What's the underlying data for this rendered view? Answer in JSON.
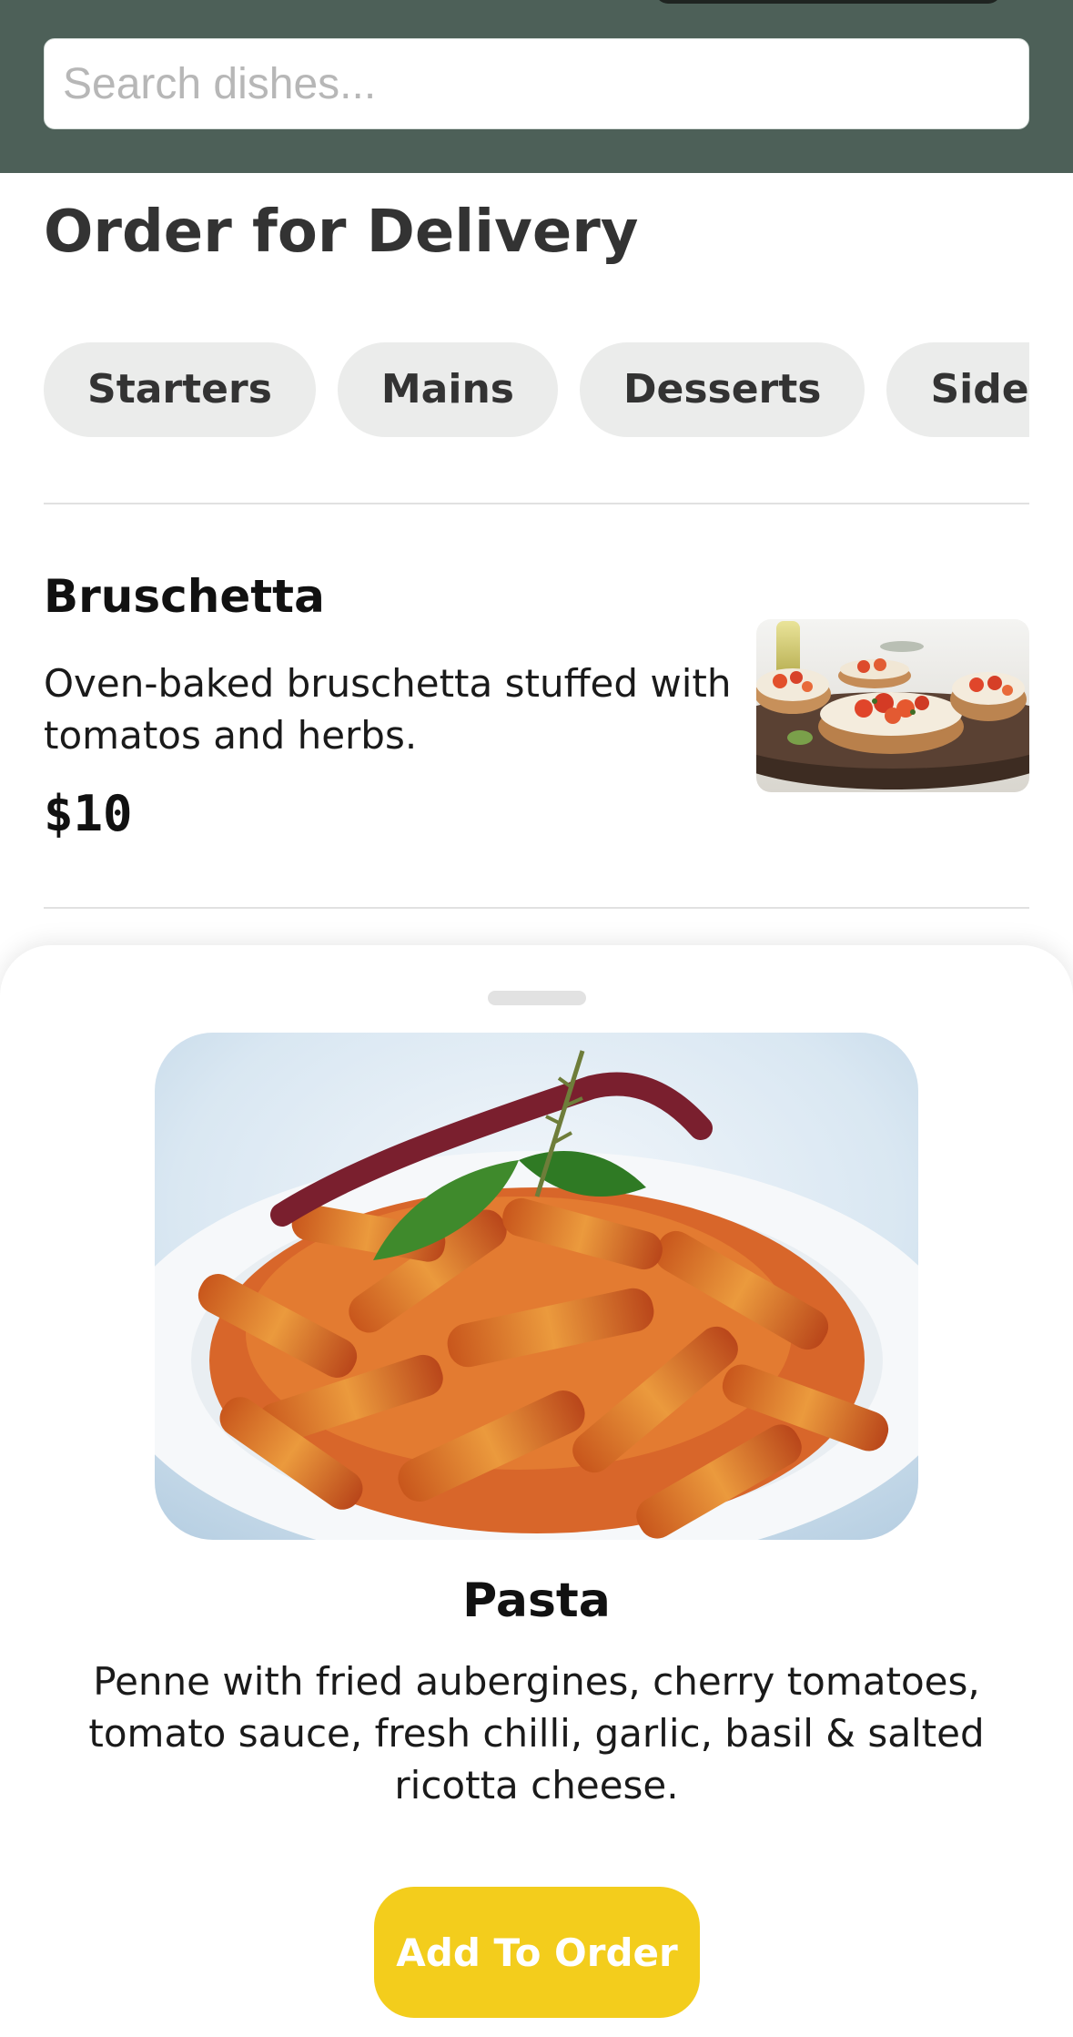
{
  "search": {
    "placeholder": "Search dishes...",
    "value": ""
  },
  "page": {
    "title": "Order for Delivery"
  },
  "categories": [
    {
      "label": "Starters"
    },
    {
      "label": "Mains"
    },
    {
      "label": "Desserts"
    },
    {
      "label": "Sides"
    }
  ],
  "menu_items": [
    {
      "name": "Bruschetta",
      "description": "Oven-baked bruschetta stuffed with tomatos and herbs.",
      "price": "$10",
      "image_icon": "bruschetta-photo"
    }
  ],
  "detail_sheet": {
    "title": "Pasta",
    "description": "Penne with fried aubergines, cherry tomatoes, tomato sauce, fresh chilli, garlic, basil & salted ricotta cheese.",
    "button_label": "Add To Order",
    "image_icon": "pasta-photo"
  },
  "colors": {
    "header_bg": "#4d6058",
    "pill_bg": "#ebeceb",
    "accent_button": "#f3cd1c"
  }
}
